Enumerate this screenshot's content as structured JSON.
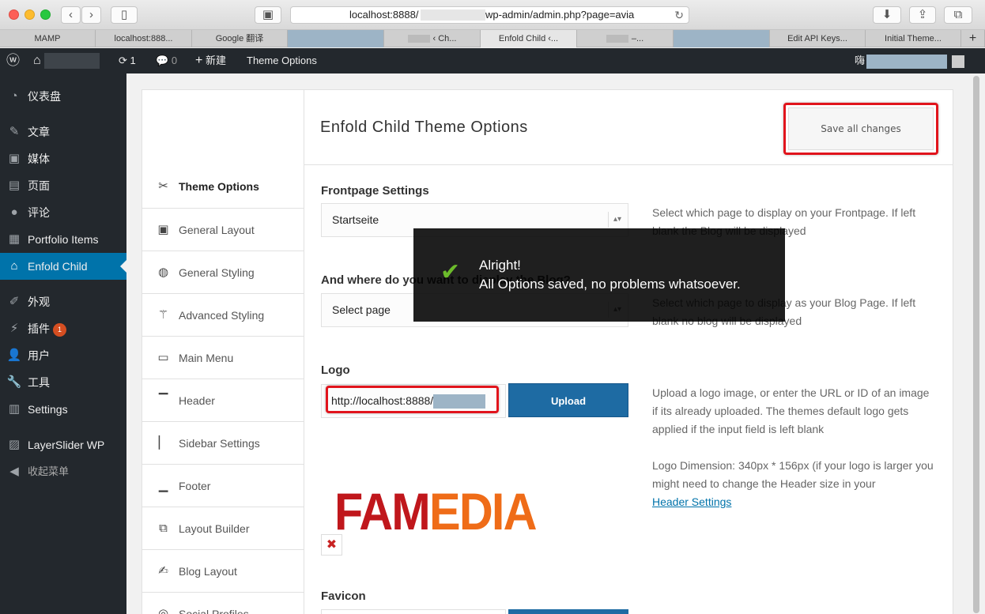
{
  "browser": {
    "url_prefix": "localhost:8888/",
    "url_suffix": "wp-admin/admin.php?page=avia",
    "tabs": [
      {
        "label": "MAMP"
      },
      {
        "label": "localhost:888..."
      },
      {
        "label": "Google 翻译"
      },
      {
        "label": ""
      },
      {
        "label": "‹ Ch..."
      },
      {
        "label": "Enfold Child ‹..."
      },
      {
        "label": "–..."
      },
      {
        "label": ""
      },
      {
        "label": "Edit API Keys..."
      },
      {
        "label": "Initial Theme..."
      }
    ]
  },
  "adminbar": {
    "updates_count": "1",
    "comments_count": "0",
    "new_label": "新建",
    "theme_options_label": "Theme Options",
    "greeting": "嗨"
  },
  "sidebar": {
    "items": [
      {
        "label": "仪表盘"
      },
      {
        "label": "文章"
      },
      {
        "label": "媒体"
      },
      {
        "label": "页面"
      },
      {
        "label": "评论"
      },
      {
        "label": "Portfolio Items"
      },
      {
        "label": "Enfold Child"
      },
      {
        "label": "外观"
      },
      {
        "label": "插件"
      },
      {
        "label": "用户"
      },
      {
        "label": "工具"
      },
      {
        "label": "Settings"
      },
      {
        "label": "LayerSlider WP"
      },
      {
        "label": "收起菜单"
      }
    ],
    "plugins_badge": "1"
  },
  "options": {
    "title": "Enfold Child Theme Options",
    "save_label": "Save all changes",
    "nav": [
      {
        "label": "Theme Options"
      },
      {
        "label": "General Layout"
      },
      {
        "label": "General Styling"
      },
      {
        "label": "Advanced Styling"
      },
      {
        "label": "Main Menu"
      },
      {
        "label": "Header"
      },
      {
        "label": "Sidebar Settings"
      },
      {
        "label": "Footer"
      },
      {
        "label": "Layout Builder"
      },
      {
        "label": "Blog Layout"
      },
      {
        "label": "Social Profiles"
      }
    ],
    "frontpage": {
      "title": "Frontpage Settings",
      "value": "Startseite",
      "desc": "Select which page to display on your Frontpage. If left blank the Blog will be displayed"
    },
    "blog": {
      "title": "And where do you want to display the Blog?",
      "value": "Select page",
      "desc": "Select which page to display as your Blog Page. If left blank no blog will be displayed"
    },
    "logo": {
      "title": "Logo",
      "value": "http://localhost:8888/",
      "upload_label": "Upload",
      "desc1": "Upload a logo image, or enter the URL or ID of an image if its already uploaded. The themes default logo gets applied if the input field is left blank",
      "desc2": "Logo Dimension: 340px * 156px (if your logo is larger you might need to change the Header size in your",
      "link": "Header Settings",
      "logo_text_a": "FAM",
      "logo_text_b": "EDIA",
      "remove": "✖"
    },
    "favicon": {
      "title": "Favicon"
    }
  },
  "toast": {
    "title": "Alright!",
    "message": "All Options saved, no problems whatsoever."
  }
}
